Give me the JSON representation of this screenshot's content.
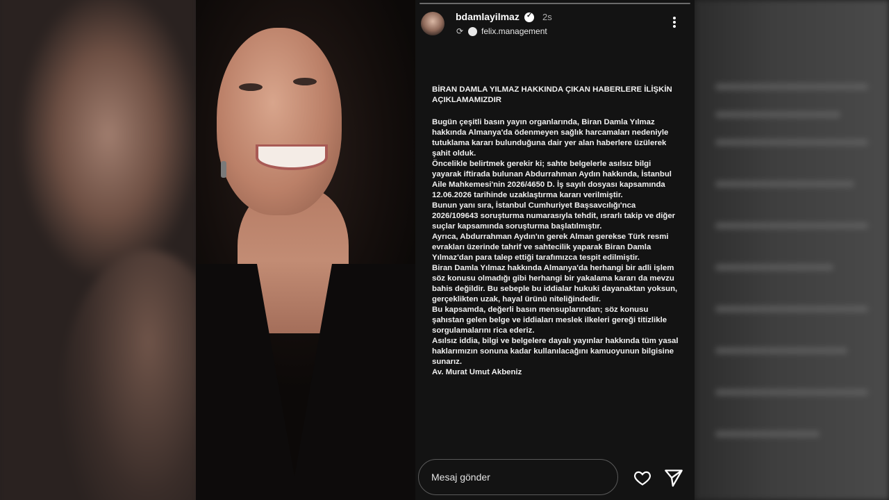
{
  "story": {
    "username": "bdamlayilmaz",
    "time": "2s",
    "repost_account": "felix.management",
    "title": "BİRAN DAMLA YILMAZ HAKKINDA ÇIKAN HABERLERE İLİŞKİN AÇIKLAMAMIZDIR",
    "paragraphs": [
      "Bugün çeşitli basın yayın organlarında, Biran Damla Yılmaz hakkında Almanya'da ödenmeyen sağlık harcamaları nedeniyle tutuklama kararı bulunduğuna dair yer alan haberlere üzülerek şahit olduk.",
      "Öncelikle belirtmek gerekir ki; sahte belgelerle asılsız bilgi yayarak iftirada bulunan Abdurrahman Aydın hakkında, İstanbul Aile Mahkemesi'nin 2026/4650 D. İş sayılı dosyası kapsamında 12.06.2026 tarihinde uzaklaştırma kararı verilmiştir.",
      "Bunun yanı sıra, İstanbul Cumhuriyet Başsavcılığı'nca 2026/109643 soruşturma numarasıyla tehdit, ısrarlı takip ve diğer suçlar kapsamında soruşturma başlatılmıştır.",
      "Ayrıca, Abdurrahman Aydın'ın gerek Alman gerekse Türk resmi evrakları üzerinde tahrif ve sahtecilik yaparak Biran Damla Yılmaz'dan para talep ettiği tarafımızca tespit edilmiştir.",
      "Biran Damla Yılmaz hakkında Almanya'da herhangi bir adli işlem söz konusu olmadığı gibi herhangi bir yakalama kararı da mevzu bahis değildir. Bu sebeple bu iddialar hukuki dayanaktan yoksun, gerçeklikten uzak, hayal ürünü niteliğindedir.",
      "Bu kapsamda, değerli basın mensuplarından; söz konusu şahıstan gelen belge ve iddiaları meslek ilkeleri gereği titizlikle sorgulamalarını rica ederiz.",
      "Asılsız iddia, bilgi ve belgelere dayalı yayınlar hakkında tüm yasal haklarımızın sonuna kadar kullanılacağını kamuoyunun bilgisine sunarız.",
      "Av. Murat Umut Akbeniz"
    ]
  },
  "composer": {
    "placeholder": "Mesaj gönder"
  },
  "icons": {
    "more": "more-vertical-icon",
    "verified": "verified-badge-icon",
    "repost": "repost-icon",
    "like": "heart-icon",
    "send": "send-icon"
  },
  "colors": {
    "story_bg": "#131313",
    "text": "#ffffff",
    "muted": "#b0b0b0"
  }
}
